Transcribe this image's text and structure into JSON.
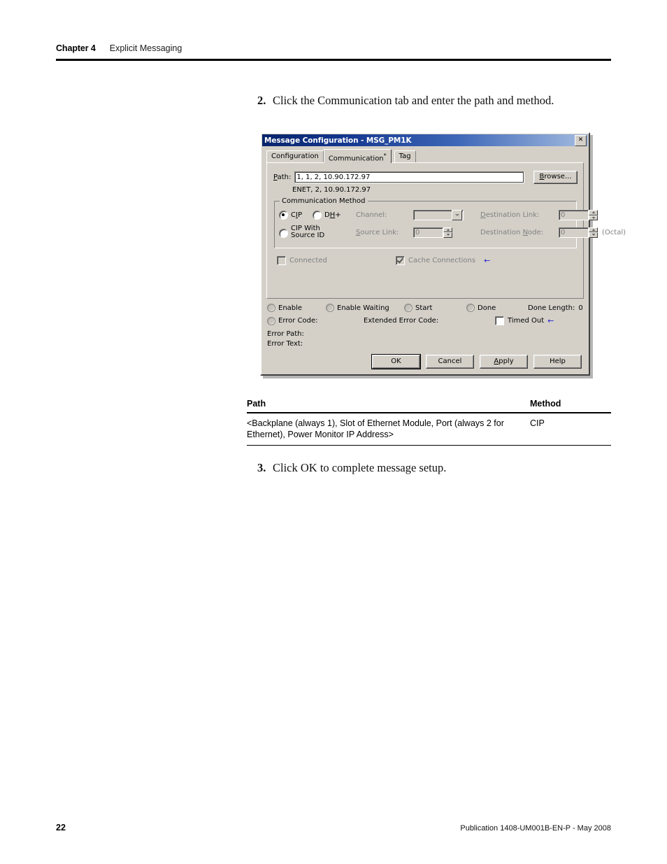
{
  "header": {
    "chapter": "Chapter 4",
    "topic": "Explicit Messaging"
  },
  "steps": [
    {
      "num": "2.",
      "text": "Click the Communication tab and enter the path and method."
    },
    {
      "num": "3.",
      "text": "Click OK to complete message setup."
    }
  ],
  "dialog": {
    "title": "Message Configuration - MSG_PM1K",
    "close_label": "✕",
    "tabs": [
      {
        "label": "Configuration",
        "active": false,
        "asterisk": ""
      },
      {
        "label": "Communication",
        "active": true,
        "asterisk": "*"
      },
      {
        "label": "Tag",
        "active": false,
        "asterisk": ""
      }
    ],
    "path": {
      "label": "Path:",
      "value": "1, 1, 2, 10.90.172.97",
      "placeholder": "",
      "resolved": "ENET, 2, 10.90.172.97",
      "browse_label": "Browse..."
    },
    "communication_method": {
      "legend": "Communication Method",
      "options": [
        {
          "label": "CIP",
          "selected": true
        },
        {
          "label": "DH+",
          "selected": false
        },
        {
          "label": "CIP With Source ID",
          "selected": false
        }
      ],
      "channel_label": "Channel:",
      "channel_value": "",
      "source_link_label": "Source Link:",
      "source_link_value": "0",
      "destination_link_label": "Destination Link:",
      "destination_link_value": "0",
      "destination_node_label": "Destination Node:",
      "destination_node_value": "0",
      "octal_label": "(Octal)"
    },
    "options": {
      "connected_label": "Connected",
      "connected_checked": false,
      "cache_label": "Cache Connections",
      "cache_checked": true,
      "marker": "←"
    },
    "status": {
      "enable_label": "Enable",
      "enable_waiting_label": "Enable Waiting",
      "start_label": "Start",
      "done_label": "Done",
      "done_length_label": "Done Length:",
      "done_length_value": "0",
      "error_code_label": "Error Code:",
      "extended_error_code_label": "Extended Error Code:",
      "timed_out_label": "Timed Out",
      "timed_out_checked": false,
      "timed_out_marker": "←",
      "error_path_label": "Error Path:",
      "error_text_label": "Error Text:"
    },
    "buttons": [
      {
        "label": "OK",
        "default": true
      },
      {
        "label": "Cancel",
        "default": false
      },
      {
        "label": "Apply",
        "default": false
      },
      {
        "label": "Help",
        "default": false
      }
    ]
  },
  "table": {
    "columns": [
      "Path",
      "Method"
    ],
    "rows": [
      {
        "path": "<Backplane (always 1), Slot of Ethernet Module, Port (always 2 for Ethernet), Power Monitor IP Address>",
        "method": "CIP"
      }
    ]
  },
  "footer": {
    "page_number": "22",
    "publication": "Publication 1408-UM001B-EN-P - May 2008"
  },
  "colors": {
    "title_bar_start": "#08246b",
    "title_bar_end": "#a3bbdf",
    "dialog_face": "#d4d0c8",
    "marker_blue": "#2222cc",
    "rule_black": "#000000"
  }
}
